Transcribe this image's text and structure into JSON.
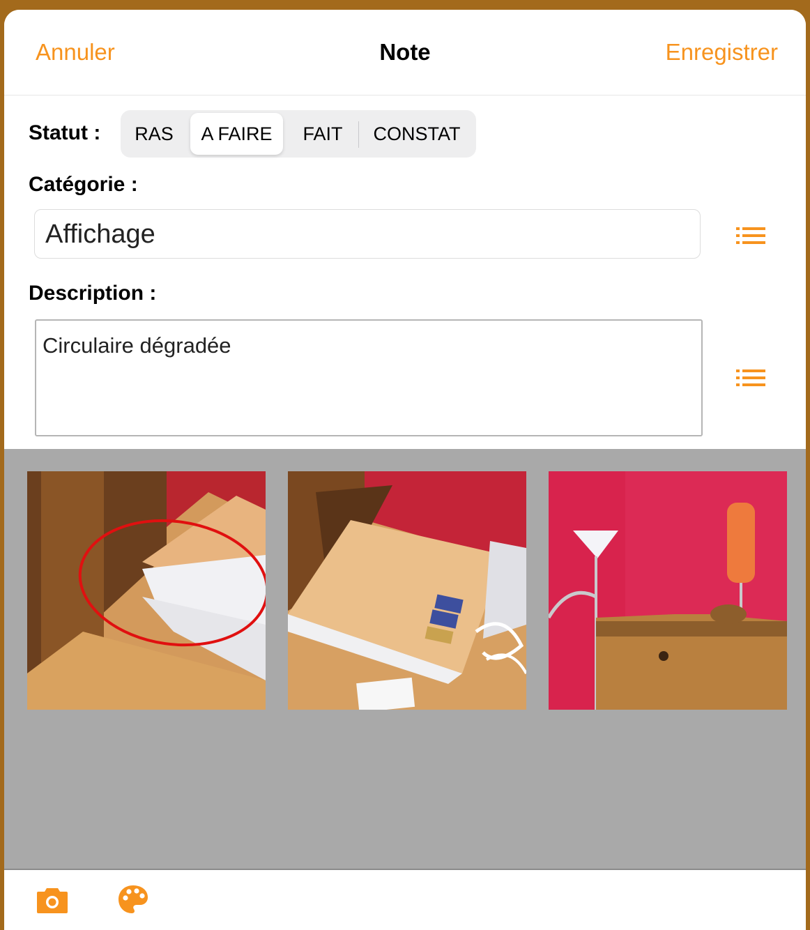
{
  "header": {
    "cancel_label": "Annuler",
    "title": "Note",
    "save_label": "Enregistrer"
  },
  "status": {
    "label": "Statut :",
    "options": [
      "RAS",
      "A FAIRE",
      "FAIT",
      "CONSTAT"
    ],
    "selected": "A FAIRE"
  },
  "category": {
    "label": "Catégorie :",
    "value": "Affichage",
    "list_icon": "list-icon"
  },
  "description": {
    "label": "Description :",
    "value": "Circulaire dégradée",
    "list_icon": "list-icon"
  },
  "photos": [
    {
      "icon": "photo-thumbnail",
      "subject": "stack of folders on desk with red circle annotation"
    },
    {
      "icon": "photo-thumbnail",
      "subject": "large envelope with stamps on desk"
    },
    {
      "icon": "photo-thumbnail",
      "subject": "pink wall with lamps and wooden cabinet"
    }
  ],
  "toolbar": {
    "camera_icon": "camera-icon",
    "palette_icon": "palette-icon"
  },
  "colors": {
    "accent": "#f7931e",
    "gallery_bg": "#a9a9a9",
    "window_edge": "#a36a1c"
  }
}
